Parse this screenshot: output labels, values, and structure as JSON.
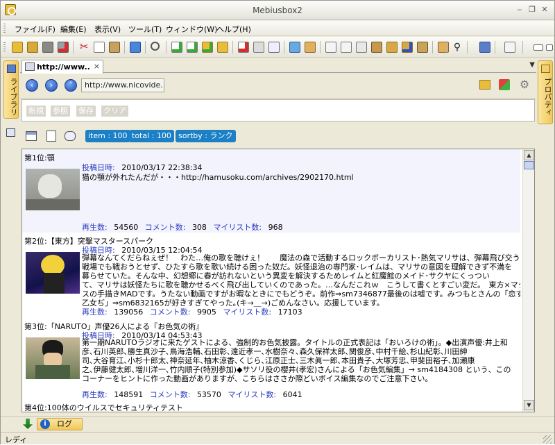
{
  "window": {
    "title": "Mebiusbox2"
  },
  "menu": [
    "ファイル(F)",
    "編集(E)",
    "表示(V)",
    "ツール(T)",
    "ウィンドウ(W)",
    "ヘルプ(H)"
  ],
  "side": {
    "left_label": "ライブラリ",
    "right_label": "プロパティ"
  },
  "tab": {
    "label": "http://www...",
    "close": "×"
  },
  "url": {
    "value": "http://www.nicovide..."
  },
  "search_buttons": [
    "新規",
    "参照",
    "保存",
    "クリア"
  ],
  "filters": {
    "item": "item : 100",
    "total": "total : 100",
    "sortby": "sortby : ランク"
  },
  "labels": {
    "posted": "投稿日時:",
    "plays": "再生数:",
    "comments": "コメント数:",
    "mylist": "マイリスト数:"
  },
  "results": [
    {
      "rank": "第1位:顎",
      "posted": "2010/03/17 22:38:34",
      "description": [
        "猫の顎が外れたんだが・・・http://hamusoku.com/archives/2902170.html"
      ],
      "plays": "54560",
      "comments": "308",
      "mylist": "968"
    },
    {
      "rank": "第2位:【東方】突撃マスタースパーク",
      "posted": "2010/03/15 12:04:54",
      "description": [
        "弾幕なんてくだらねぇぜ！　わた…俺の歌を聴けぇ！　　魔法の森で活動するロックボーカリスト･熱気マリサは、弾幕飛び交う",
        "戦場でも戦おうとせず、ひたすら歌を歌い続ける困った奴だ。妖怪退治の専門家･レイムは、マリサの意図を理解できず不満を",
        "募らせていた。そんな中、幻想郷に春が訪れないという異変を解決するためレイムと紅魔館のメイド･サクヤにくっつい",
        "て、マリサは妖怪たちに歌を聴かせるべく飛び出していくのであった。…なんだこれｗ　こうして書くとすごい変だ。　東方×マクロ",
        "スの手描きMADです。うたない動画ですがお暇なときにでもどうぞ。前作⇒sm7346877最後のは嘘です。みつもとさんの「恋する",
        "乙女ぢ」⇒sm6832165が好きすぎてやった｡(キ→＿→)ごめんなさい。応援しています。"
      ],
      "plays": "139056",
      "comments": "9905",
      "mylist": "17103"
    },
    {
      "rank": "第3位:「NARUTO」声優26人による『お色気の術』",
      "posted": "2010/03/14 04:53:43",
      "description": [
        "第一期NARUTOラジオに来たゲストによる、強制的お色気披露。タイトルの正式表記は「おいろけの術」。◆出演声優:井上和",
        "彦､石川英郎､勝生真沙子､鳥海浩輔､石田彰､遠近孝一､水樹奈々､森久保祥太郎､関俊彦､中村千絵､杉山紀彰､川田紳",
        "司､大谷育江､小杉十郎太､神奈延年､柚木涼香､くじら､江原正士､三木眞一郎､本田貴子､大塚芳忠､甲斐田裕子､加瀬康",
        "之､伊藤健太郎､増川洋一､竹内順子(特別参加)◆サソリ役の櫻井(孝宏)さんによる「お色気編集」→ sm4184308 という、この",
        "コーナーをヒントに作った動画がありますが、こちらはささか際どいボイス編集なのでご注意下さい。"
      ],
      "plays": "148591",
      "comments": "53570",
      "mylist": "6041"
    },
    {
      "rank": "第4位:100体のウイルスでセキュリティテスト",
      "posted": "",
      "description": [],
      "plays": "",
      "comments": "",
      "mylist": ""
    }
  ],
  "bottom": {
    "log_tab": "ログ"
  },
  "status": {
    "text": "レディ"
  },
  "colors": {
    "pill": "#1b80c6",
    "label": "#2a3dbf",
    "accent_tab": "#f1c85a"
  }
}
